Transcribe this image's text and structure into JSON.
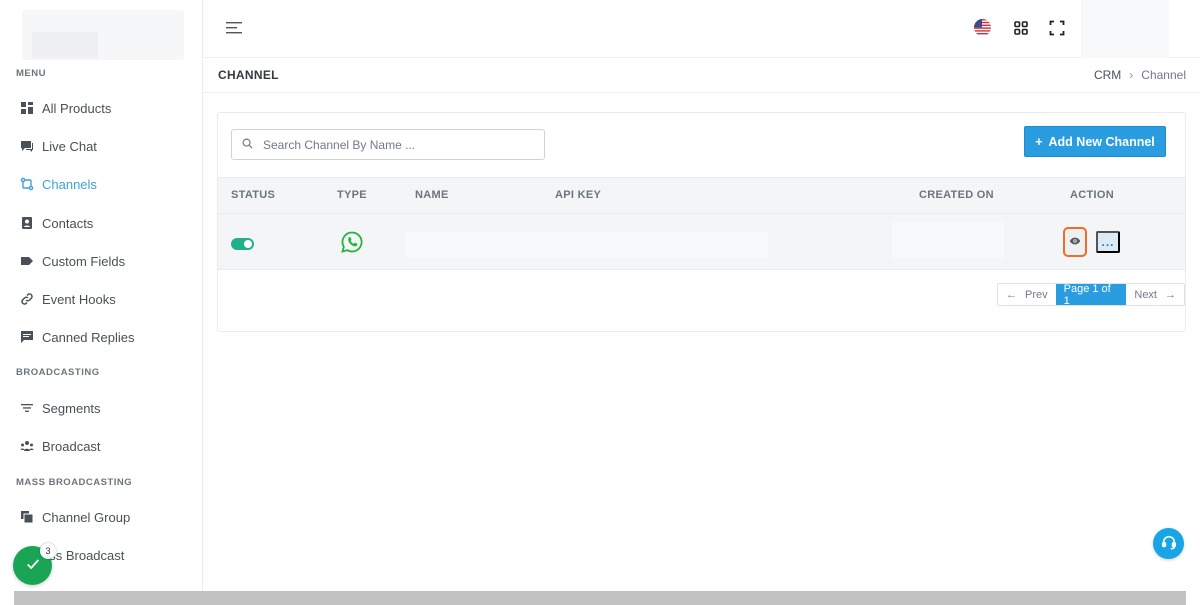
{
  "sidebar": {
    "sections": [
      {
        "title": "MENU"
      },
      {
        "title": "BROADCASTING"
      },
      {
        "title": "MASS BROADCASTING"
      }
    ],
    "items": [
      {
        "label": "All Products",
        "icon": "grid-icon"
      },
      {
        "label": "Live Chat",
        "icon": "chat-icon"
      },
      {
        "label": "Channels",
        "icon": "channels-icon",
        "active": true
      },
      {
        "label": "Contacts",
        "icon": "contact-book-icon"
      },
      {
        "label": "Custom Fields",
        "icon": "tag-icon"
      },
      {
        "label": "Event Hooks",
        "icon": "link-icon"
      },
      {
        "label": "Canned Replies",
        "icon": "message-icon"
      },
      {
        "label": "Segments",
        "icon": "filter-icon"
      },
      {
        "label": "Broadcast",
        "icon": "users-icon"
      },
      {
        "label": "Channel Group",
        "icon": "layers-icon"
      },
      {
        "label": "ass Broadcast",
        "icon": "broadcast-icon"
      }
    ]
  },
  "page": {
    "title": "CHANNEL",
    "breadcrumb": [
      "CRM",
      "Channel"
    ]
  },
  "toolbar": {
    "search_placeholder": "Search Channel By Name ...",
    "add_button_label": "Add New Channel"
  },
  "table": {
    "headers": [
      "STATUS",
      "TYPE",
      "NAME",
      "API KEY",
      "CREATED ON",
      "ACTION"
    ],
    "rows": [
      {
        "status": "on",
        "type": "whatsapp-icon",
        "more_label": "..."
      }
    ]
  },
  "pagination": {
    "prev_label": "Prev",
    "current_label": "Page 1 of 1",
    "next_label": "Next"
  },
  "notifications": {
    "count": "3"
  },
  "colors": {
    "accent": "#2a9ce0",
    "active_nav": "#3ea2d9",
    "toggle_on": "#20b18a",
    "whatsapp": "#25b33f",
    "highlight_border": "#ef6c2a",
    "success_fab": "#19a554"
  }
}
